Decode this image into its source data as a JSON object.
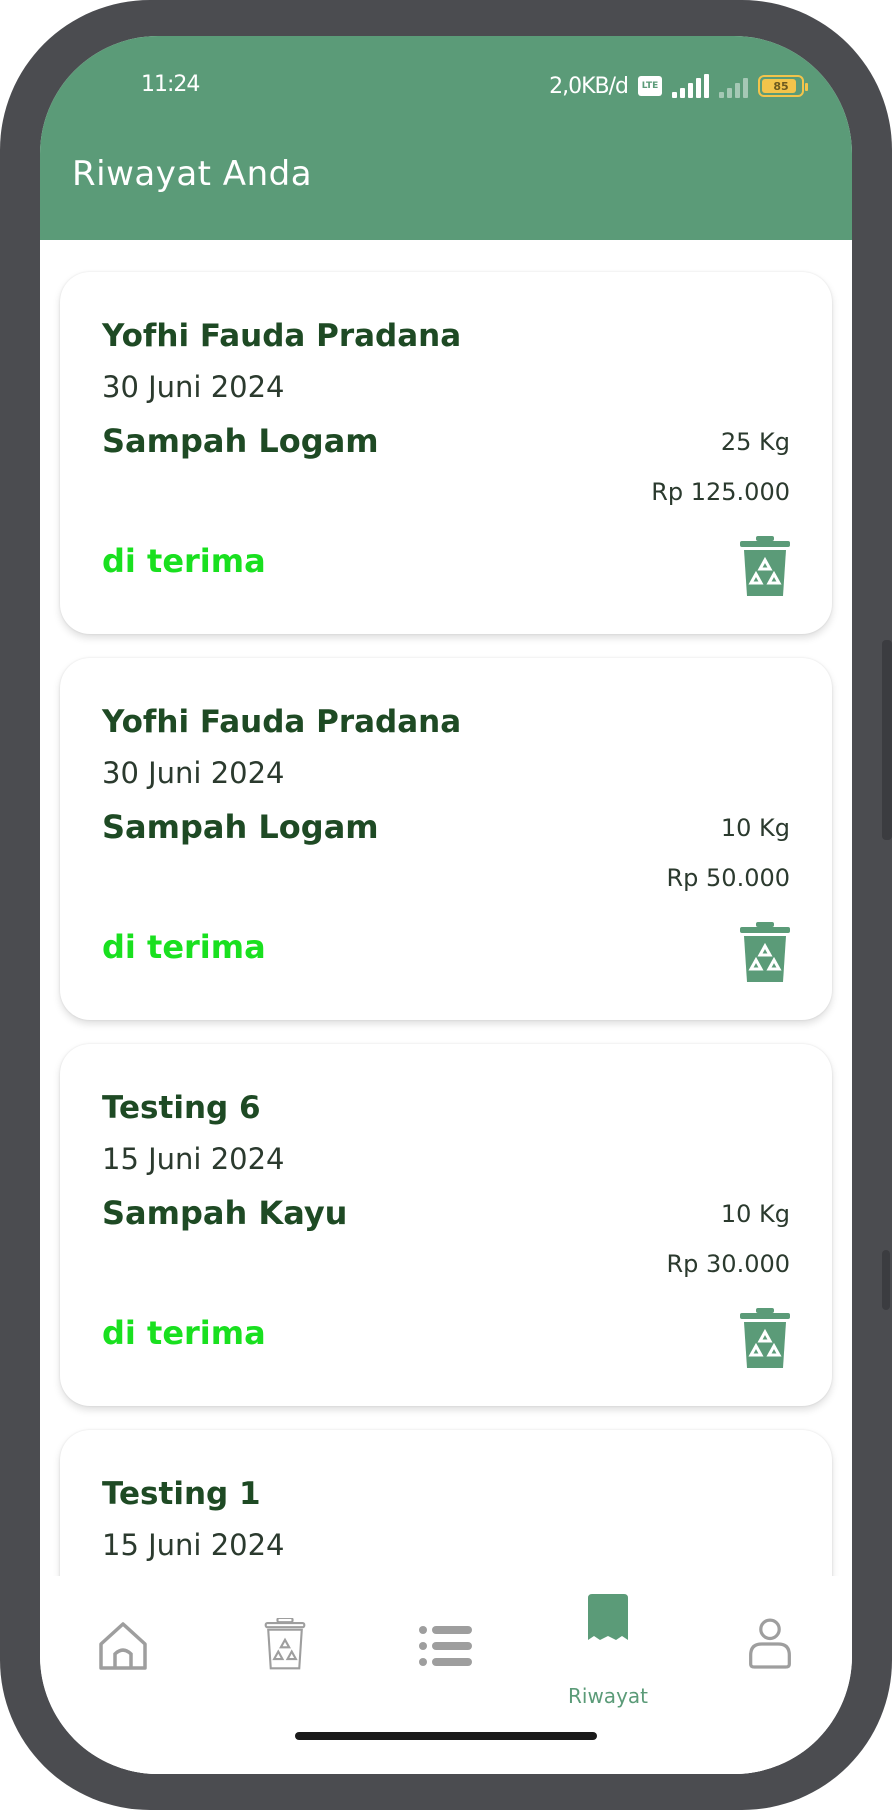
{
  "status_bar": {
    "time": "11:24",
    "net_speed": "2,0KB/d",
    "volte_label": "Vo LTE",
    "network_label": "4G",
    "battery_level": "85"
  },
  "header": {
    "title": "Riwayat Anda"
  },
  "history": [
    {
      "name": "Yofhi Fauda Pradana",
      "date": "30 Juni 2024",
      "type": "Sampah Logam",
      "weight": "25 Kg",
      "price": "Rp 125.000",
      "status": "di terima"
    },
    {
      "name": "Yofhi Fauda Pradana",
      "date": "30 Juni 2024",
      "type": "Sampah Logam",
      "weight": "10 Kg",
      "price": "Rp 50.000",
      "status": "di terima"
    },
    {
      "name": "Testing 6",
      "date": "15 Juni 2024",
      "type": "Sampah Kayu",
      "weight": "10 Kg",
      "price": "Rp 30.000",
      "status": "di terima"
    },
    {
      "name": "Testing 1",
      "date": "15 Juni 2024",
      "type": "",
      "weight": "",
      "price": "",
      "status": ""
    }
  ],
  "bottom_nav": {
    "items": [
      {
        "icon": "home-icon",
        "label": ""
      },
      {
        "icon": "recycle-bin-icon",
        "label": ""
      },
      {
        "icon": "list-icon",
        "label": ""
      },
      {
        "icon": "history-receipt-icon",
        "label": "Riwayat",
        "active": true
      },
      {
        "icon": "profile-icon",
        "label": ""
      }
    ]
  },
  "colors": {
    "primary": "#5b9b78",
    "status_accepted": "#19e01f",
    "title_text": "#1e4a24",
    "frame": "#4b4c50"
  }
}
